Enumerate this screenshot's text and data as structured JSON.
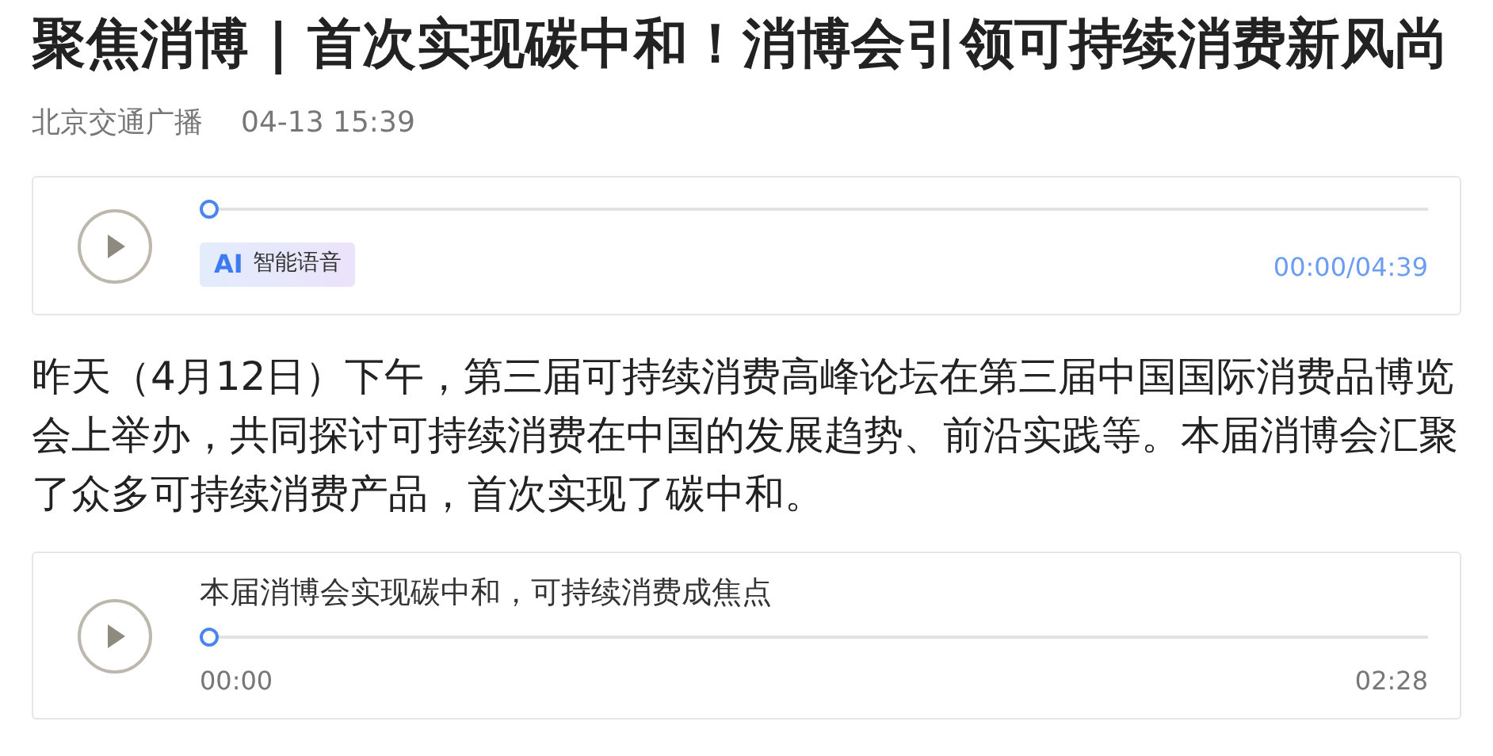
{
  "title": "聚焦消博 | 首次实现碳中和！消博会引领可持续消费新风尚",
  "meta": {
    "source": "北京交通广播",
    "time": "04-13 15:39"
  },
  "ai_player": {
    "badge_mark": "AI",
    "badge_label": "智能语音",
    "level": 0,
    "time": "00:00/04:39"
  },
  "paragraph": "昨天（4月12日）下午，第三届可持续消费高峰论坛在第三届中国国际消费品博览会上举办，共同探讨可持续消费在中国的发展趋势、前沿实践等。本届消博会汇聚了众多可持续消费产品，首次实现了碳中和。",
  "audio_player": {
    "title": "本届消博会实现碳中和，可持续消费成焦点",
    "level": 0,
    "elapsed": "00:00",
    "duration": "02:28"
  }
}
